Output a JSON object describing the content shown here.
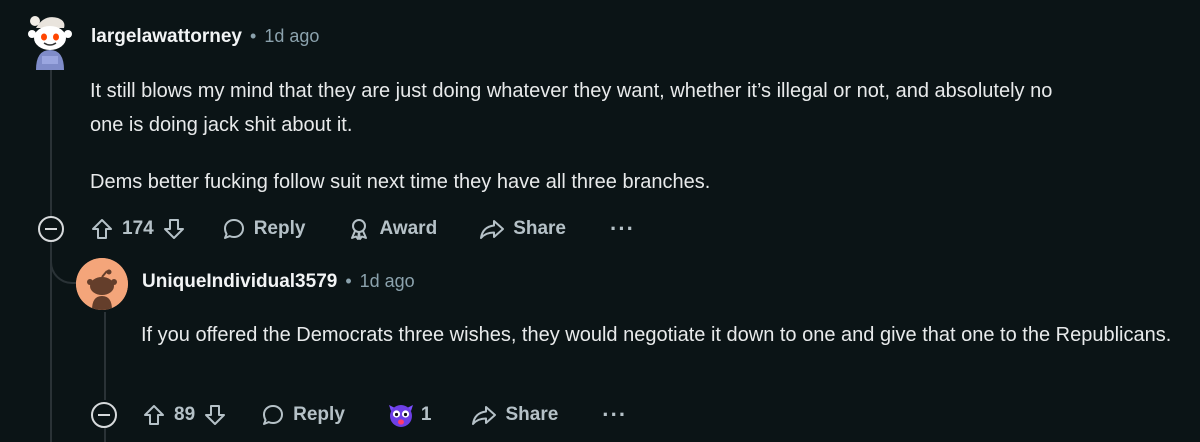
{
  "comment1": {
    "username": "largelawattorney",
    "separator": "•",
    "time": "1d ago",
    "paragraphs": [
      "It still blows my mind that they are just doing whatever they want, whether it’s illegal or not, and absolutely no one is doing jack shit about it.",
      "Dems better fucking follow suit next time they have all three branches."
    ],
    "votes": "174",
    "reply_label": "Reply",
    "award_label": "Award",
    "share_label": "Share",
    "more_label": "···"
  },
  "comment2": {
    "username": "UniqueIndividual3579",
    "separator": "•",
    "time": "1d ago",
    "paragraphs": [
      "If you offered the Democrats three wishes, they would negotiate it down to one and give that one to the Republicans."
    ],
    "votes": "89",
    "reply_label": "Reply",
    "award_count": "1",
    "share_label": "Share",
    "more_label": "···"
  },
  "colors": {
    "background": "#0b1416",
    "text": "#e8eaeb",
    "meta": "#8ba2ad",
    "action": "#b5c1c7",
    "avatar2_bg": "#f4a57a"
  },
  "icons": [
    "snoo-avatar-icon",
    "upvote-icon",
    "downvote-icon",
    "reply-bubble-icon",
    "award-icon",
    "share-arrow-icon",
    "collapse-icon",
    "award-shocked-face-icon"
  ]
}
